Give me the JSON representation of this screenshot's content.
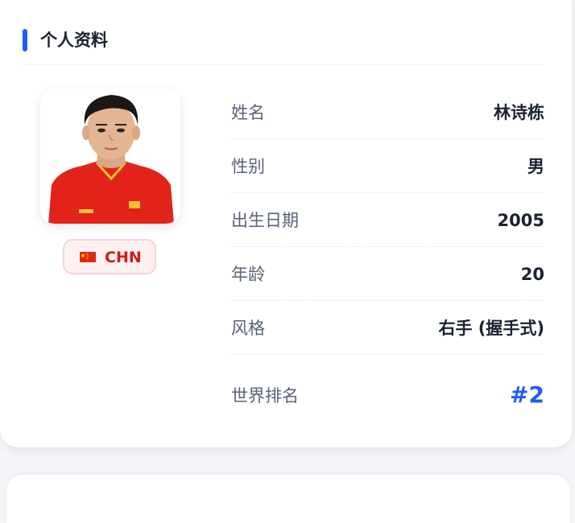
{
  "section": {
    "title": "个人资料",
    "accent_color": "#1f5cf3"
  },
  "player": {
    "photo_icon": "player-portrait-icon",
    "country_code": "CHN",
    "flag_icon": "china-flag-icon"
  },
  "profile_rows": [
    {
      "label": "姓名",
      "value": "林诗栋"
    },
    {
      "label": "性别",
      "value": "男"
    },
    {
      "label": "出生日期",
      "value": "2005"
    },
    {
      "label": "年龄",
      "value": "20"
    },
    {
      "label": "风格",
      "value": "右手 (握手式)"
    },
    {
      "label": "世界排名",
      "value": "#2",
      "value_color": "#1f5cf3"
    }
  ]
}
